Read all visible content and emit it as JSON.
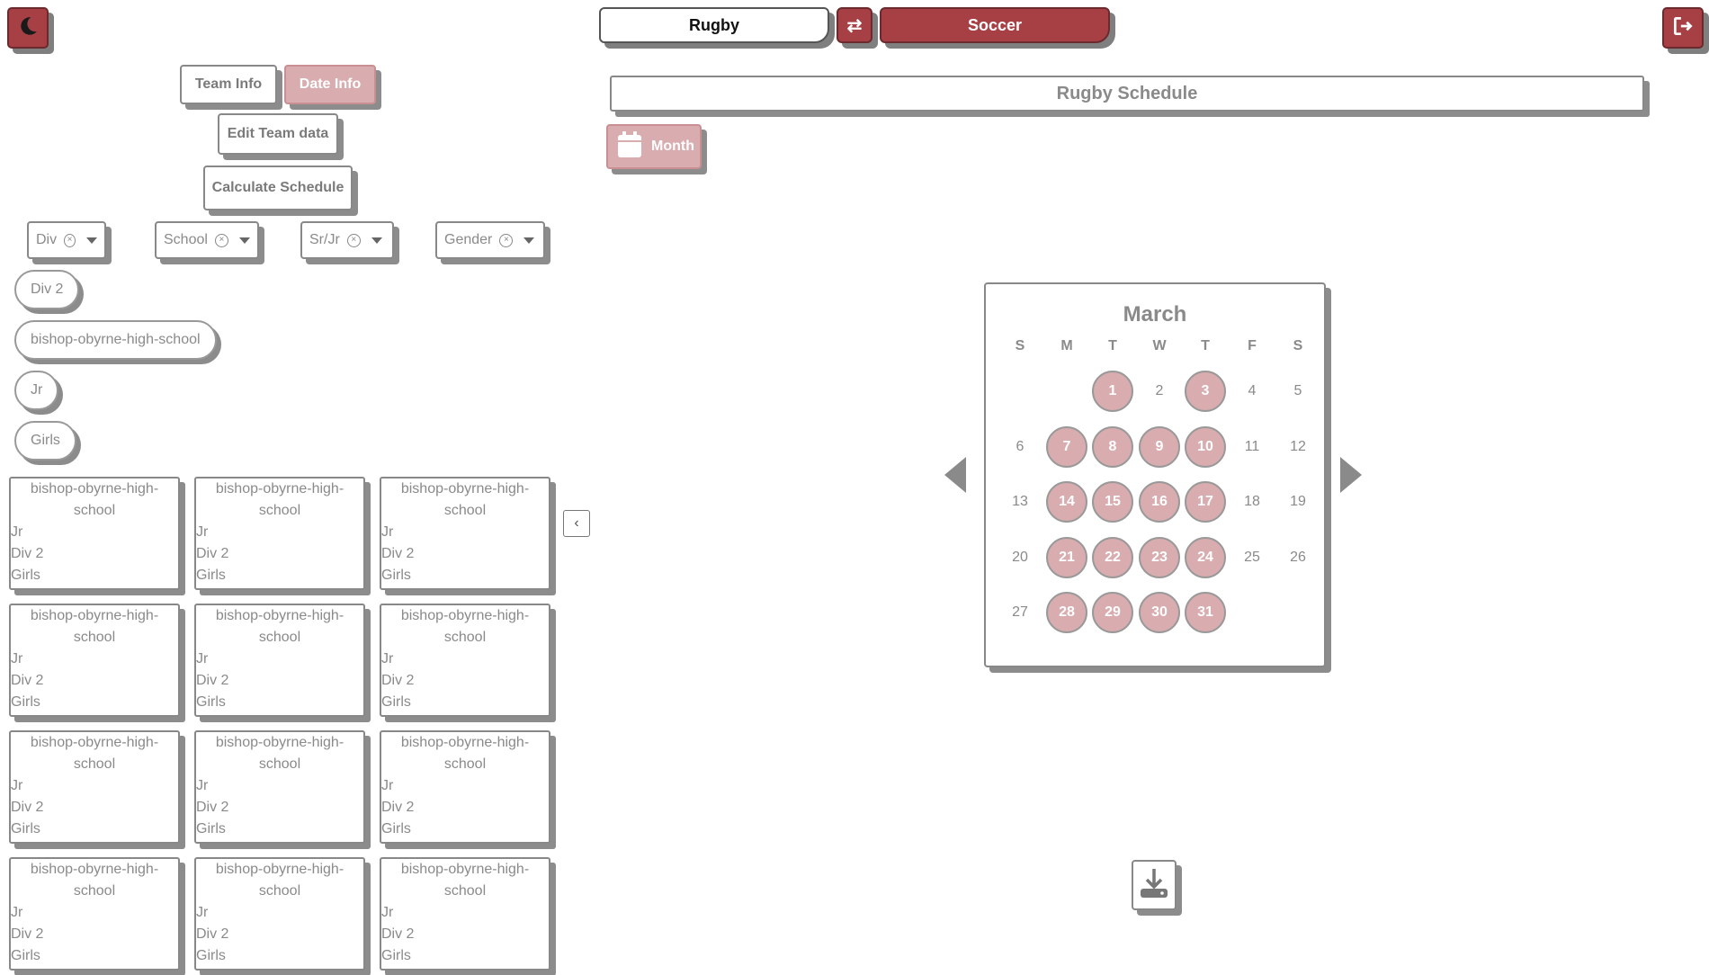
{
  "header": {
    "left_sport": "Rugby",
    "right_sport": "Soccer",
    "swap_icon": "swap-icon",
    "theme_icon": "moon-icon",
    "logout_icon": "logout-icon"
  },
  "sidebar": {
    "team_info_label": "Team Info",
    "date_info_label": "Date Info",
    "edit_team_label": "Edit Team data",
    "calculate_label": "Calculate Schedule",
    "filters": [
      {
        "label": "Div"
      },
      {
        "label": "School"
      },
      {
        "label": "Sr/Jr"
      },
      {
        "label": "Gender"
      }
    ],
    "chips": [
      "Div 2",
      "bishop-obyrne-high-school",
      "Jr",
      "Girls"
    ],
    "cards": [
      {
        "school": "bishop-obyrne-high-school",
        "level": "Jr",
        "div": "Div 2",
        "gender": "Girls"
      },
      {
        "school": "bishop-obyrne-high-school",
        "level": "Jr",
        "div": "Div 2",
        "gender": "Girls"
      },
      {
        "school": "bishop-obyrne-high-school",
        "level": "Jr",
        "div": "Div 2",
        "gender": "Girls"
      },
      {
        "school": "bishop-obyrne-high-school",
        "level": "Jr",
        "div": "Div 2",
        "gender": "Girls"
      },
      {
        "school": "bishop-obyrne-high-school",
        "level": "Jr",
        "div": "Div 2",
        "gender": "Girls"
      },
      {
        "school": "bishop-obyrne-high-school",
        "level": "Jr",
        "div": "Div 2",
        "gender": "Girls"
      },
      {
        "school": "bishop-obyrne-high-school",
        "level": "Jr",
        "div": "Div 2",
        "gender": "Girls"
      },
      {
        "school": "bishop-obyrne-high-school",
        "level": "Jr",
        "div": "Div 2",
        "gender": "Girls"
      },
      {
        "school": "bishop-obyrne-high-school",
        "level": "Jr",
        "div": "Div 2",
        "gender": "Girls"
      },
      {
        "school": "bishop-obyrne-high-school",
        "level": "Jr",
        "div": "Div 2",
        "gender": "Girls"
      },
      {
        "school": "bishop-obyrne-high-school",
        "level": "Jr",
        "div": "Div 2",
        "gender": "Girls"
      },
      {
        "school": "bishop-obyrne-high-school",
        "level": "Jr",
        "div": "Div 2",
        "gender": "Girls"
      }
    ]
  },
  "main": {
    "title": "Rugby Schedule",
    "view_label": "Month",
    "calendar": {
      "month": "March",
      "weekdays": [
        "S",
        "M",
        "T",
        "W",
        "T",
        "F",
        "S"
      ],
      "first_weekday": 2,
      "days_in_month": 31,
      "selected_days": [
        1,
        3,
        7,
        8,
        9,
        10,
        14,
        15,
        16,
        17,
        21,
        22,
        23,
        24,
        28,
        29,
        30,
        31
      ]
    }
  },
  "colors": {
    "accent": "#a64045",
    "accent_light": "#d9acaf",
    "text_muted": "#8a8a8a"
  }
}
